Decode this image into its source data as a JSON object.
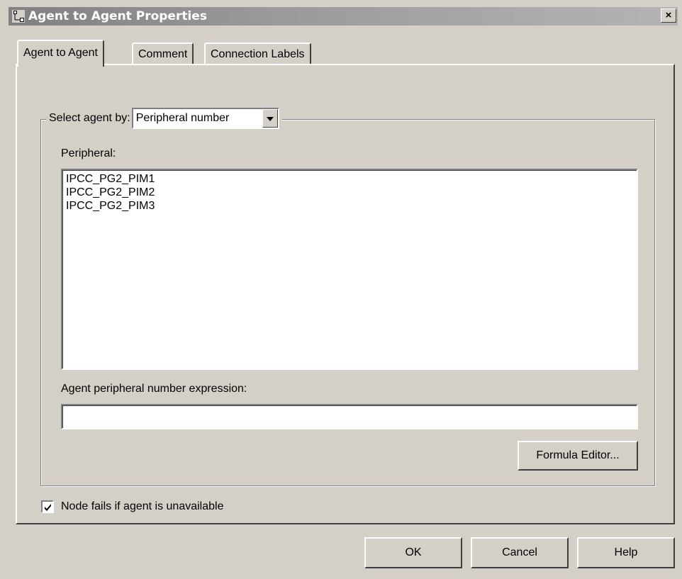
{
  "window": {
    "title": "Agent to Agent Properties",
    "close_label": "×",
    "icon": "node-properties-icon"
  },
  "tabs": [
    {
      "label": "Agent to Agent",
      "active": true
    },
    {
      "label": "Comment",
      "active": false
    },
    {
      "label": "Connection Labels",
      "active": false
    }
  ],
  "group": {
    "select_label": "Select agent by:",
    "select_value": "Peripheral number"
  },
  "peripheral": {
    "label": "Peripheral:",
    "items": [
      "IPCC_PG2_PIM1",
      "IPCC_PG2_PIM2",
      "IPCC_PG2_PIM3"
    ]
  },
  "expression": {
    "label": "Agent peripheral number expression:",
    "value": ""
  },
  "formula_button": "Formula Editor...",
  "checkbox": {
    "label": "Node fails if agent is unavailable",
    "checked": true
  },
  "buttons": {
    "ok": "OK",
    "cancel": "Cancel",
    "help": "Help"
  },
  "colors": {
    "dialog_bg": "#d4d0c8",
    "title_bar": "#808080",
    "title_text": "#ffffff"
  }
}
